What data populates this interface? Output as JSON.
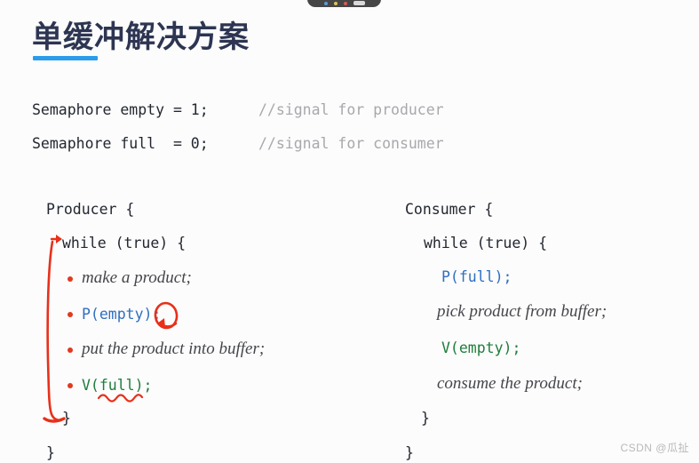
{
  "slide": {
    "title": "单缓冲解决方案",
    "accent_color": "#2b9cea",
    "title_color": "#2d3552",
    "background_color": "#fcfcfc"
  },
  "recorder_toolbar": {
    "present": true,
    "color": "#464646"
  },
  "declarations": [
    {
      "code": "Semaphore empty = 1;",
      "comment": "//signal for producer"
    },
    {
      "code": "Semaphore full  = 0;",
      "comment": "//signal for consumer"
    }
  ],
  "producer": {
    "header": "Producer {",
    "while_line": "while (true) {",
    "body": [
      {
        "text": "make a product;",
        "style": "prose",
        "bullet": true
      },
      {
        "text": "P(empty);",
        "style": "blue",
        "bullet": true
      },
      {
        "text": "put the product into buffer;",
        "style": "prose",
        "bullet": true
      },
      {
        "text": "V(full);",
        "style": "green",
        "bullet": true
      }
    ],
    "close_inner": "}",
    "close_outer": "}"
  },
  "consumer": {
    "header": "Consumer {",
    "while_line": "while (true) {",
    "body": [
      {
        "text": "P(full);",
        "style": "blue",
        "bullet": false
      },
      {
        "text": "pick product from buffer;",
        "style": "prose",
        "bullet": false
      },
      {
        "text": "V(empty);",
        "style": "green",
        "bullet": false
      },
      {
        "text": "consume the product;",
        "style": "prose",
        "bullet": false
      }
    ],
    "close_inner": "}",
    "close_outer": "}"
  },
  "annotations": {
    "color": "#e8301a",
    "items": [
      {
        "name": "loop-bracket",
        "kind": "bracket-with-arrow",
        "target": "producer while-loop body"
      },
      {
        "name": "semicolon-circle",
        "kind": "ellipse-with-arrow",
        "target": "P(empty); semicolon"
      },
      {
        "name": "full-squiggle",
        "kind": "squiggly-underline",
        "target": "V(full) full"
      }
    ]
  },
  "watermark": {
    "text": "CSDN @瓜扯"
  }
}
